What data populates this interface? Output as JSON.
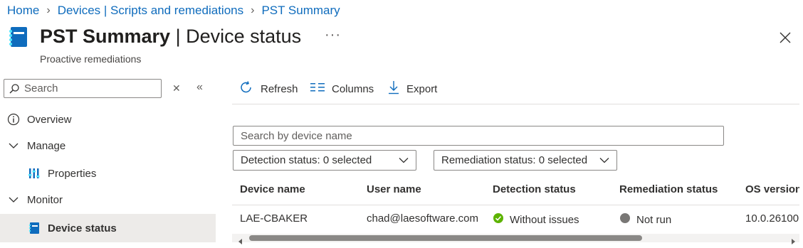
{
  "breadcrumb": [
    "Home",
    "Devices | Scripts and remediations",
    "PST Summary"
  ],
  "header": {
    "title_bold": "PST Summary",
    "title_rest": " | Device status",
    "subtitle": "Proactive remediations",
    "more": "···"
  },
  "sidebar": {
    "search_placeholder": "Search",
    "items": [
      {
        "label": "Overview",
        "icon": "info-icon"
      },
      {
        "label": "Manage",
        "icon": "chevron-down-icon"
      },
      {
        "label": "Properties",
        "icon": "properties-icon"
      },
      {
        "label": "Monitor",
        "icon": "chevron-down-icon"
      },
      {
        "label": "Device status",
        "icon": "script-icon"
      }
    ]
  },
  "toolbar": {
    "refresh": "Refresh",
    "columns": "Columns",
    "export": "Export"
  },
  "filters": {
    "device_search_placeholder": "Search by device name",
    "detection": "Detection status: 0 selected",
    "remediation": "Remediation status: 0 selected"
  },
  "table": {
    "columns": [
      "Device name",
      "User name",
      "Detection status",
      "Remediation status",
      "OS version"
    ],
    "rows": [
      {
        "device": "LAE-CBAKER",
        "user": "chad@laesoftware.com",
        "detection": "Without issues",
        "remediation": "Not run",
        "os": "10.0.26100"
      }
    ]
  },
  "colors": {
    "accent": "#0f6cbd",
    "success": "#5db300",
    "neutral_dot": "#797775",
    "selected_bg": "#edebe9"
  }
}
